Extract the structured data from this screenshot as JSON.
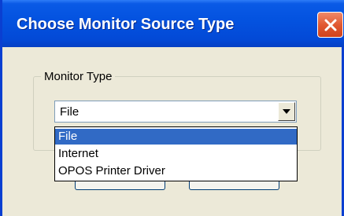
{
  "window": {
    "title": "Choose Monitor Source Type"
  },
  "group": {
    "label": "Monitor Type"
  },
  "combo": {
    "selected": "File",
    "options": [
      "File",
      "Internet",
      "OPOS Printer Driver"
    ],
    "highlighted_index": 0
  },
  "icons": {
    "close": "close-icon",
    "dropdown_arrow": "chevron-down-icon"
  },
  "colors": {
    "titlebar": "#0453e0",
    "selection": "#316ac5",
    "close_button": "#e15a33",
    "window_background": "#ece9d8"
  }
}
